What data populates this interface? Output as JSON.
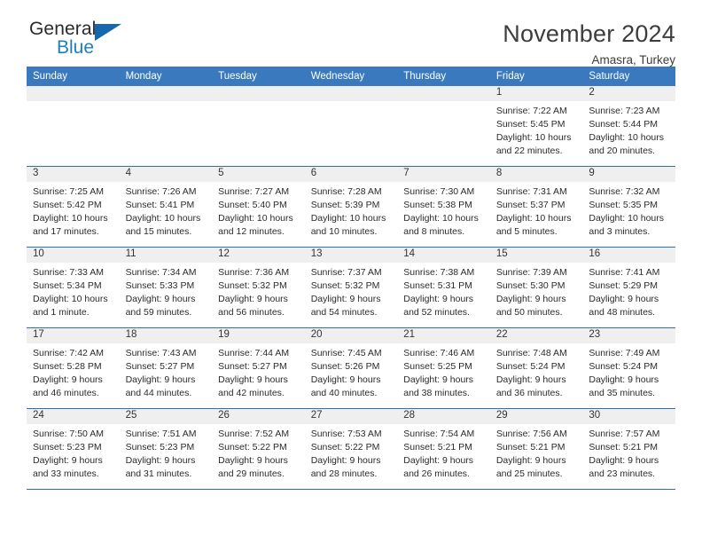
{
  "brand": {
    "name_part1": "General",
    "name_part2": "Blue",
    "triangle_icon": "triangle-icon"
  },
  "header": {
    "title": "November 2024",
    "subtitle": "Amasra, Turkey"
  },
  "colors": {
    "header_blue": "#3a79bd",
    "grid_blue": "#2f6fb5",
    "date_strip_gray": "#efefef",
    "logo_blue": "#1b7fc4"
  },
  "weekday_headers": [
    "Sunday",
    "Monday",
    "Tuesday",
    "Wednesday",
    "Thursday",
    "Friday",
    "Saturday"
  ],
  "labels": {
    "sunrise_prefix": "Sunrise:",
    "sunset_prefix": "Sunset:",
    "daylight_prefix": "Daylight:"
  },
  "weeks": [
    [
      {
        "empty": true
      },
      {
        "empty": true
      },
      {
        "empty": true
      },
      {
        "empty": true
      },
      {
        "empty": true
      },
      {
        "date": "1",
        "sunrise": "Sunrise: 7:22 AM",
        "sunset": "Sunset: 5:45 PM",
        "daylight_line1": "Daylight: 10 hours",
        "daylight_line2": "and 22 minutes."
      },
      {
        "date": "2",
        "sunrise": "Sunrise: 7:23 AM",
        "sunset": "Sunset: 5:44 PM",
        "daylight_line1": "Daylight: 10 hours",
        "daylight_line2": "and 20 minutes."
      }
    ],
    [
      {
        "date": "3",
        "sunrise": "Sunrise: 7:25 AM",
        "sunset": "Sunset: 5:42 PM",
        "daylight_line1": "Daylight: 10 hours",
        "daylight_line2": "and 17 minutes."
      },
      {
        "date": "4",
        "sunrise": "Sunrise: 7:26 AM",
        "sunset": "Sunset: 5:41 PM",
        "daylight_line1": "Daylight: 10 hours",
        "daylight_line2": "and 15 minutes."
      },
      {
        "date": "5",
        "sunrise": "Sunrise: 7:27 AM",
        "sunset": "Sunset: 5:40 PM",
        "daylight_line1": "Daylight: 10 hours",
        "daylight_line2": "and 12 minutes."
      },
      {
        "date": "6",
        "sunrise": "Sunrise: 7:28 AM",
        "sunset": "Sunset: 5:39 PM",
        "daylight_line1": "Daylight: 10 hours",
        "daylight_line2": "and 10 minutes."
      },
      {
        "date": "7",
        "sunrise": "Sunrise: 7:30 AM",
        "sunset": "Sunset: 5:38 PM",
        "daylight_line1": "Daylight: 10 hours",
        "daylight_line2": "and 8 minutes."
      },
      {
        "date": "8",
        "sunrise": "Sunrise: 7:31 AM",
        "sunset": "Sunset: 5:37 PM",
        "daylight_line1": "Daylight: 10 hours",
        "daylight_line2": "and 5 minutes."
      },
      {
        "date": "9",
        "sunrise": "Sunrise: 7:32 AM",
        "sunset": "Sunset: 5:35 PM",
        "daylight_line1": "Daylight: 10 hours",
        "daylight_line2": "and 3 minutes."
      }
    ],
    [
      {
        "date": "10",
        "sunrise": "Sunrise: 7:33 AM",
        "sunset": "Sunset: 5:34 PM",
        "daylight_line1": "Daylight: 10 hours",
        "daylight_line2": "and 1 minute."
      },
      {
        "date": "11",
        "sunrise": "Sunrise: 7:34 AM",
        "sunset": "Sunset: 5:33 PM",
        "daylight_line1": "Daylight: 9 hours",
        "daylight_line2": "and 59 minutes."
      },
      {
        "date": "12",
        "sunrise": "Sunrise: 7:36 AM",
        "sunset": "Sunset: 5:32 PM",
        "daylight_line1": "Daylight: 9 hours",
        "daylight_line2": "and 56 minutes."
      },
      {
        "date": "13",
        "sunrise": "Sunrise: 7:37 AM",
        "sunset": "Sunset: 5:32 PM",
        "daylight_line1": "Daylight: 9 hours",
        "daylight_line2": "and 54 minutes."
      },
      {
        "date": "14",
        "sunrise": "Sunrise: 7:38 AM",
        "sunset": "Sunset: 5:31 PM",
        "daylight_line1": "Daylight: 9 hours",
        "daylight_line2": "and 52 minutes."
      },
      {
        "date": "15",
        "sunrise": "Sunrise: 7:39 AM",
        "sunset": "Sunset: 5:30 PM",
        "daylight_line1": "Daylight: 9 hours",
        "daylight_line2": "and 50 minutes."
      },
      {
        "date": "16",
        "sunrise": "Sunrise: 7:41 AM",
        "sunset": "Sunset: 5:29 PM",
        "daylight_line1": "Daylight: 9 hours",
        "daylight_line2": "and 48 minutes."
      }
    ],
    [
      {
        "date": "17",
        "sunrise": "Sunrise: 7:42 AM",
        "sunset": "Sunset: 5:28 PM",
        "daylight_line1": "Daylight: 9 hours",
        "daylight_line2": "and 46 minutes."
      },
      {
        "date": "18",
        "sunrise": "Sunrise: 7:43 AM",
        "sunset": "Sunset: 5:27 PM",
        "daylight_line1": "Daylight: 9 hours",
        "daylight_line2": "and 44 minutes."
      },
      {
        "date": "19",
        "sunrise": "Sunrise: 7:44 AM",
        "sunset": "Sunset: 5:27 PM",
        "daylight_line1": "Daylight: 9 hours",
        "daylight_line2": "and 42 minutes."
      },
      {
        "date": "20",
        "sunrise": "Sunrise: 7:45 AM",
        "sunset": "Sunset: 5:26 PM",
        "daylight_line1": "Daylight: 9 hours",
        "daylight_line2": "and 40 minutes."
      },
      {
        "date": "21",
        "sunrise": "Sunrise: 7:46 AM",
        "sunset": "Sunset: 5:25 PM",
        "daylight_line1": "Daylight: 9 hours",
        "daylight_line2": "and 38 minutes."
      },
      {
        "date": "22",
        "sunrise": "Sunrise: 7:48 AM",
        "sunset": "Sunset: 5:24 PM",
        "daylight_line1": "Daylight: 9 hours",
        "daylight_line2": "and 36 minutes."
      },
      {
        "date": "23",
        "sunrise": "Sunrise: 7:49 AM",
        "sunset": "Sunset: 5:24 PM",
        "daylight_line1": "Daylight: 9 hours",
        "daylight_line2": "and 35 minutes."
      }
    ],
    [
      {
        "date": "24",
        "sunrise": "Sunrise: 7:50 AM",
        "sunset": "Sunset: 5:23 PM",
        "daylight_line1": "Daylight: 9 hours",
        "daylight_line2": "and 33 minutes."
      },
      {
        "date": "25",
        "sunrise": "Sunrise: 7:51 AM",
        "sunset": "Sunset: 5:23 PM",
        "daylight_line1": "Daylight: 9 hours",
        "daylight_line2": "and 31 minutes."
      },
      {
        "date": "26",
        "sunrise": "Sunrise: 7:52 AM",
        "sunset": "Sunset: 5:22 PM",
        "daylight_line1": "Daylight: 9 hours",
        "daylight_line2": "and 29 minutes."
      },
      {
        "date": "27",
        "sunrise": "Sunrise: 7:53 AM",
        "sunset": "Sunset: 5:22 PM",
        "daylight_line1": "Daylight: 9 hours",
        "daylight_line2": "and 28 minutes."
      },
      {
        "date": "28",
        "sunrise": "Sunrise: 7:54 AM",
        "sunset": "Sunset: 5:21 PM",
        "daylight_line1": "Daylight: 9 hours",
        "daylight_line2": "and 26 minutes."
      },
      {
        "date": "29",
        "sunrise": "Sunrise: 7:56 AM",
        "sunset": "Sunset: 5:21 PM",
        "daylight_line1": "Daylight: 9 hours",
        "daylight_line2": "and 25 minutes."
      },
      {
        "date": "30",
        "sunrise": "Sunrise: 7:57 AM",
        "sunset": "Sunset: 5:21 PM",
        "daylight_line1": "Daylight: 9 hours",
        "daylight_line2": "and 23 minutes."
      }
    ]
  ]
}
